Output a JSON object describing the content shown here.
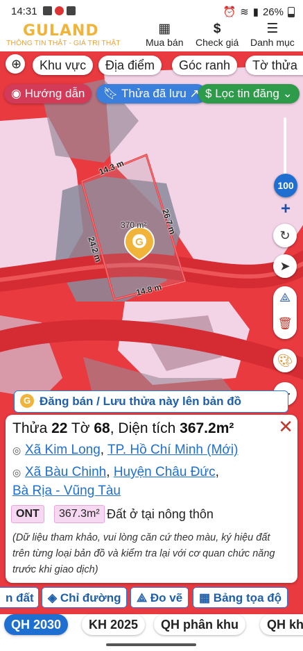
{
  "status": {
    "time": "14:31",
    "battery": "26%"
  },
  "header": {
    "logo": "GULAND",
    "tagline": "THÔNG TIN THẬT - GIÁ TRỊ THẬT",
    "nav": [
      {
        "label": "Mua bán",
        "icon": "building-icon"
      },
      {
        "label": "Check giá",
        "icon": "dollar-icon"
      },
      {
        "label": "Danh mục",
        "icon": "menu-icon"
      }
    ]
  },
  "filters": [
    "Khu vực",
    "Địa điểm",
    "Góc ranh",
    "Tờ thửa"
  ],
  "quick": {
    "guide": "Hướng dẫn",
    "saved": "Thửa đã lưu",
    "filter": "Lọc tin đăng"
  },
  "map": {
    "zoom": "100",
    "edges": {
      "top": "14.3 m",
      "right": "26.7 m",
      "left": "24.2 m",
      "bottom": "14.8 m"
    },
    "area_label": "370 m²"
  },
  "banner": "Đăng bán / Lưu thửa này lên bản đồ",
  "parcel": {
    "thua_label": "Thửa",
    "thua": "22",
    "to_label": "Tờ",
    "to": "68",
    "dt_label": "Diện tích",
    "dt": "367.2m²",
    "commune_new": "Xã Kim Long",
    "city_new": "TP. Hồ Chí Minh (Mới)",
    "commune_old": "Xã Bàu Chinh",
    "district_old": "Huyện Châu Đức",
    "province_old": "Bà Rịa - Vũng Tàu",
    "land_code": "ONT",
    "land_area": "367.3m²",
    "land_name": "Đất ở tại nông thôn",
    "note": "(Dữ liệu tham khảo, vui lòng căn cứ theo màu, ký hiệu đất trên từng loại bản đồ và kiểm tra lại với cơ quan chức năng trước khi giao dịch)"
  },
  "actions": [
    "n đất",
    "Chỉ đường",
    "Đo vẽ",
    "Bảng tọa độ"
  ],
  "layers": [
    "QH 2030",
    "KH 2025",
    "QH phân khu",
    "QH kh"
  ],
  "colors": {
    "planning_red": "#e83a3f",
    "residential_pink": "#f3d3e6",
    "accent_blue": "#1f6fd1",
    "brand_gold": "#f0b43a"
  }
}
